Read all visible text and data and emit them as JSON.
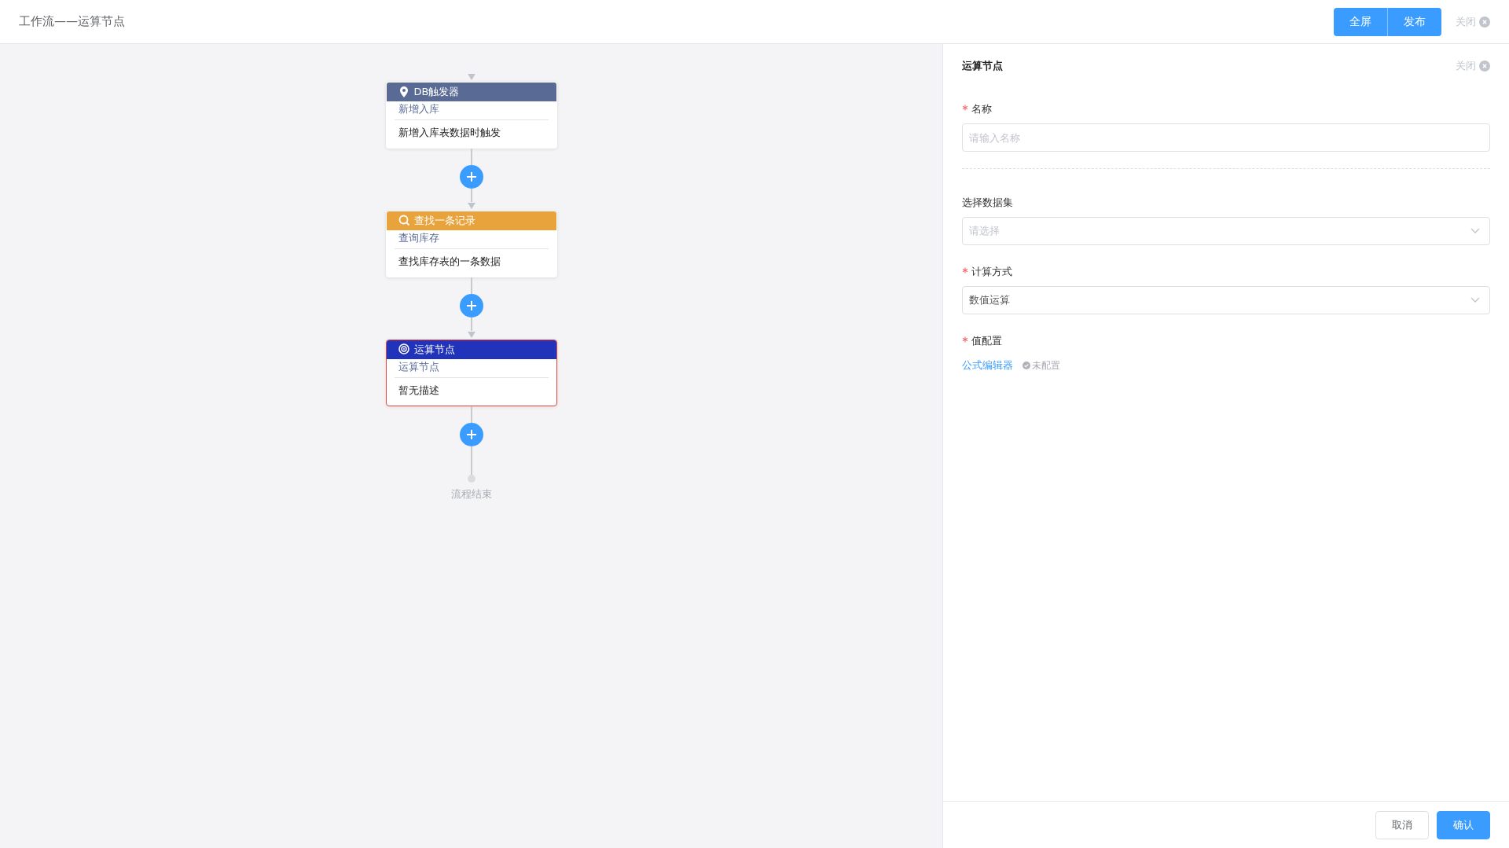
{
  "header": {
    "title": "工作流——运算节点",
    "buttons": [
      {
        "label": "全屏"
      },
      {
        "label": "发布"
      }
    ],
    "close": "关闭"
  },
  "flow": {
    "nodes": [
      {
        "kind": "trigger",
        "color": "#596a95",
        "title": "DB触发器",
        "name": "新增入库",
        "description": "新增入库表数据时触发",
        "selected": false
      },
      {
        "kind": "query",
        "color": "#e8a33d",
        "title": "查找一条记录",
        "name": "查询库存",
        "description": "查找库存表的一条数据",
        "selected": false
      },
      {
        "kind": "compute",
        "color": "#2233bb",
        "title": "运算节点",
        "name": "运算节点",
        "description": "暂无描述",
        "selected": true
      }
    ],
    "end": "流程结束"
  },
  "panel": {
    "title": "运算节点",
    "close": "关闭",
    "fields": [
      {
        "kind": "input",
        "label": "名称",
        "required": true,
        "placeholder": "请输入名称"
      },
      {
        "kind": "divider"
      },
      {
        "kind": "select",
        "label": "选择数据集",
        "required": false,
        "placeholder": "请选择"
      },
      {
        "kind": "select",
        "label": "计算方式",
        "required": true,
        "value": "数值运算"
      },
      {
        "kind": "formula",
        "label": "值配置",
        "required": true,
        "link": "公式编辑器",
        "status": "未配置"
      }
    ],
    "buttons": [
      {
        "kind": "default",
        "label": "取消"
      },
      {
        "kind": "primary",
        "label": "确认"
      }
    ]
  }
}
